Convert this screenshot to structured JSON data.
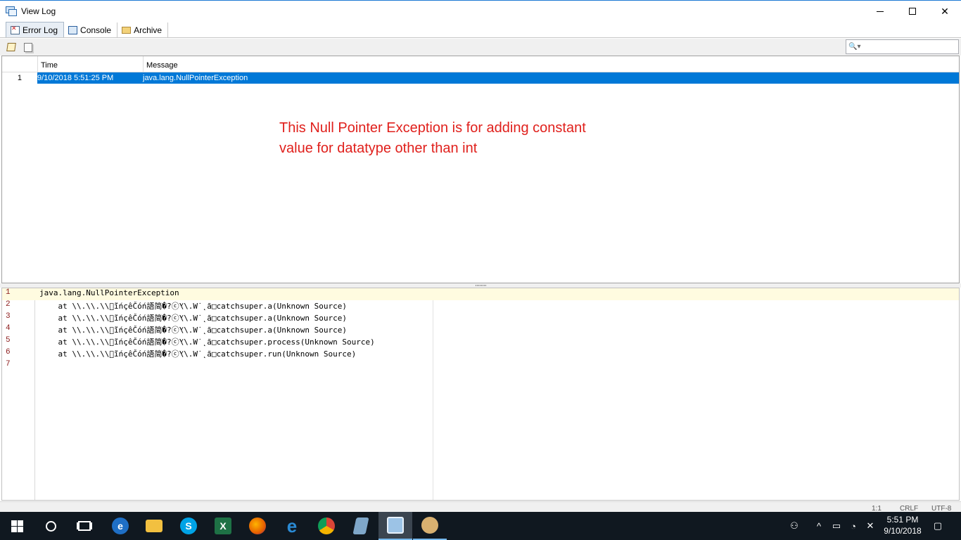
{
  "window": {
    "title": "View Log",
    "controls": {
      "minimize": "minimize",
      "maximize": "maximize",
      "close": "✕"
    }
  },
  "tabs": [
    {
      "label": "Error Log",
      "icon": "error-log-icon",
      "active": true
    },
    {
      "label": "Console",
      "icon": "console-icon",
      "active": false
    },
    {
      "label": "Archive",
      "icon": "folder-icon",
      "active": false
    }
  ],
  "toolbar": {
    "search_glyph": "🔍▾"
  },
  "log_table": {
    "columns": [
      "Time",
      "Message"
    ],
    "rows": [
      {
        "num": "1",
        "time": "9/10/2018 5:51:25 PM",
        "message": "java.lang.NullPointerException",
        "selected": true
      }
    ]
  },
  "annotation": {
    "line1": "This Null Pointer Exception is for adding constant",
    "line2": "value for datatype other than int",
    "color": "#e0201c"
  },
  "detail": {
    "lines": [
      {
        "num": "1",
        "text": "java.lang.NullPointerException"
      },
      {
        "num": "2",
        "text": "    at \\\\.\\\\.\\\\ⓒ̃ĭńçêČóń語简�?ⓒ̌\\\\.W˙˛ã□catchsuper.a(Unknown Source)"
      },
      {
        "num": "3",
        "text": "    at \\\\.\\\\.\\\\ⓒ̃ĭńçêČóń語简�?ⓒ̌\\\\.W˙˛ã□catchsuper.a(Unknown Source)"
      },
      {
        "num": "4",
        "text": "    at \\\\.\\\\.\\\\ⓒ̃ĭńçêČóń語简�?ⓒ̌\\\\.W˙˛ã□catchsuper.a(Unknown Source)"
      },
      {
        "num": "5",
        "text": "    at \\\\.\\\\.\\\\ⓒ̃ĭńçêČóń語简�?ⓒ̌\\\\.W˙˛ã□catchsuper.process(Unknown Source)"
      },
      {
        "num": "6",
        "text": "    at \\\\.\\\\.\\\\ⓒ̃ĭńçêČóń語简�?ⓒ̌\\\\.W˙˛ã□catchsuper.run(Unknown Source)"
      },
      {
        "num": "7",
        "text": ""
      }
    ]
  },
  "status": {
    "position": "1:1",
    "line_ending": "CRLF",
    "encoding": "UTF-8"
  },
  "taskbar": {
    "apps": [
      {
        "name": "Start",
        "icon": "windows-start-icon"
      },
      {
        "name": "Search",
        "icon": "search-icon"
      },
      {
        "name": "Task View",
        "icon": "task-view-icon"
      },
      {
        "name": "Edge",
        "icon": "edge-icon",
        "glyph": "e",
        "color": "#1f6fc5"
      },
      {
        "name": "File Explorer",
        "icon": "folder-icon",
        "glyph": "",
        "color": "#f2c040"
      },
      {
        "name": "Skype",
        "icon": "skype-icon",
        "glyph": "S",
        "color": "#00a3e6"
      },
      {
        "name": "Excel",
        "icon": "excel-icon",
        "glyph": "X",
        "color": "#1e7145"
      },
      {
        "name": "Firefox",
        "icon": "firefox-icon",
        "glyph": "",
        "color": "#e66000"
      },
      {
        "name": "Internet Explorer",
        "icon": "ie-icon",
        "glyph": "e",
        "color": "#2a8ad4"
      },
      {
        "name": "Chrome",
        "icon": "chrome-icon",
        "glyph": "",
        "color": "#db4437"
      },
      {
        "name": "App",
        "icon": "app-icon",
        "glyph": "",
        "color": "#7fa7c9"
      },
      {
        "name": "View Log",
        "icon": "view-log-icon",
        "glyph": "",
        "color": "#9cc3e6"
      },
      {
        "name": "Paint",
        "icon": "paint-icon",
        "glyph": "",
        "color": "#d8b070"
      }
    ],
    "clock": {
      "time": "5:51 PM",
      "date": "9/10/2018"
    }
  }
}
